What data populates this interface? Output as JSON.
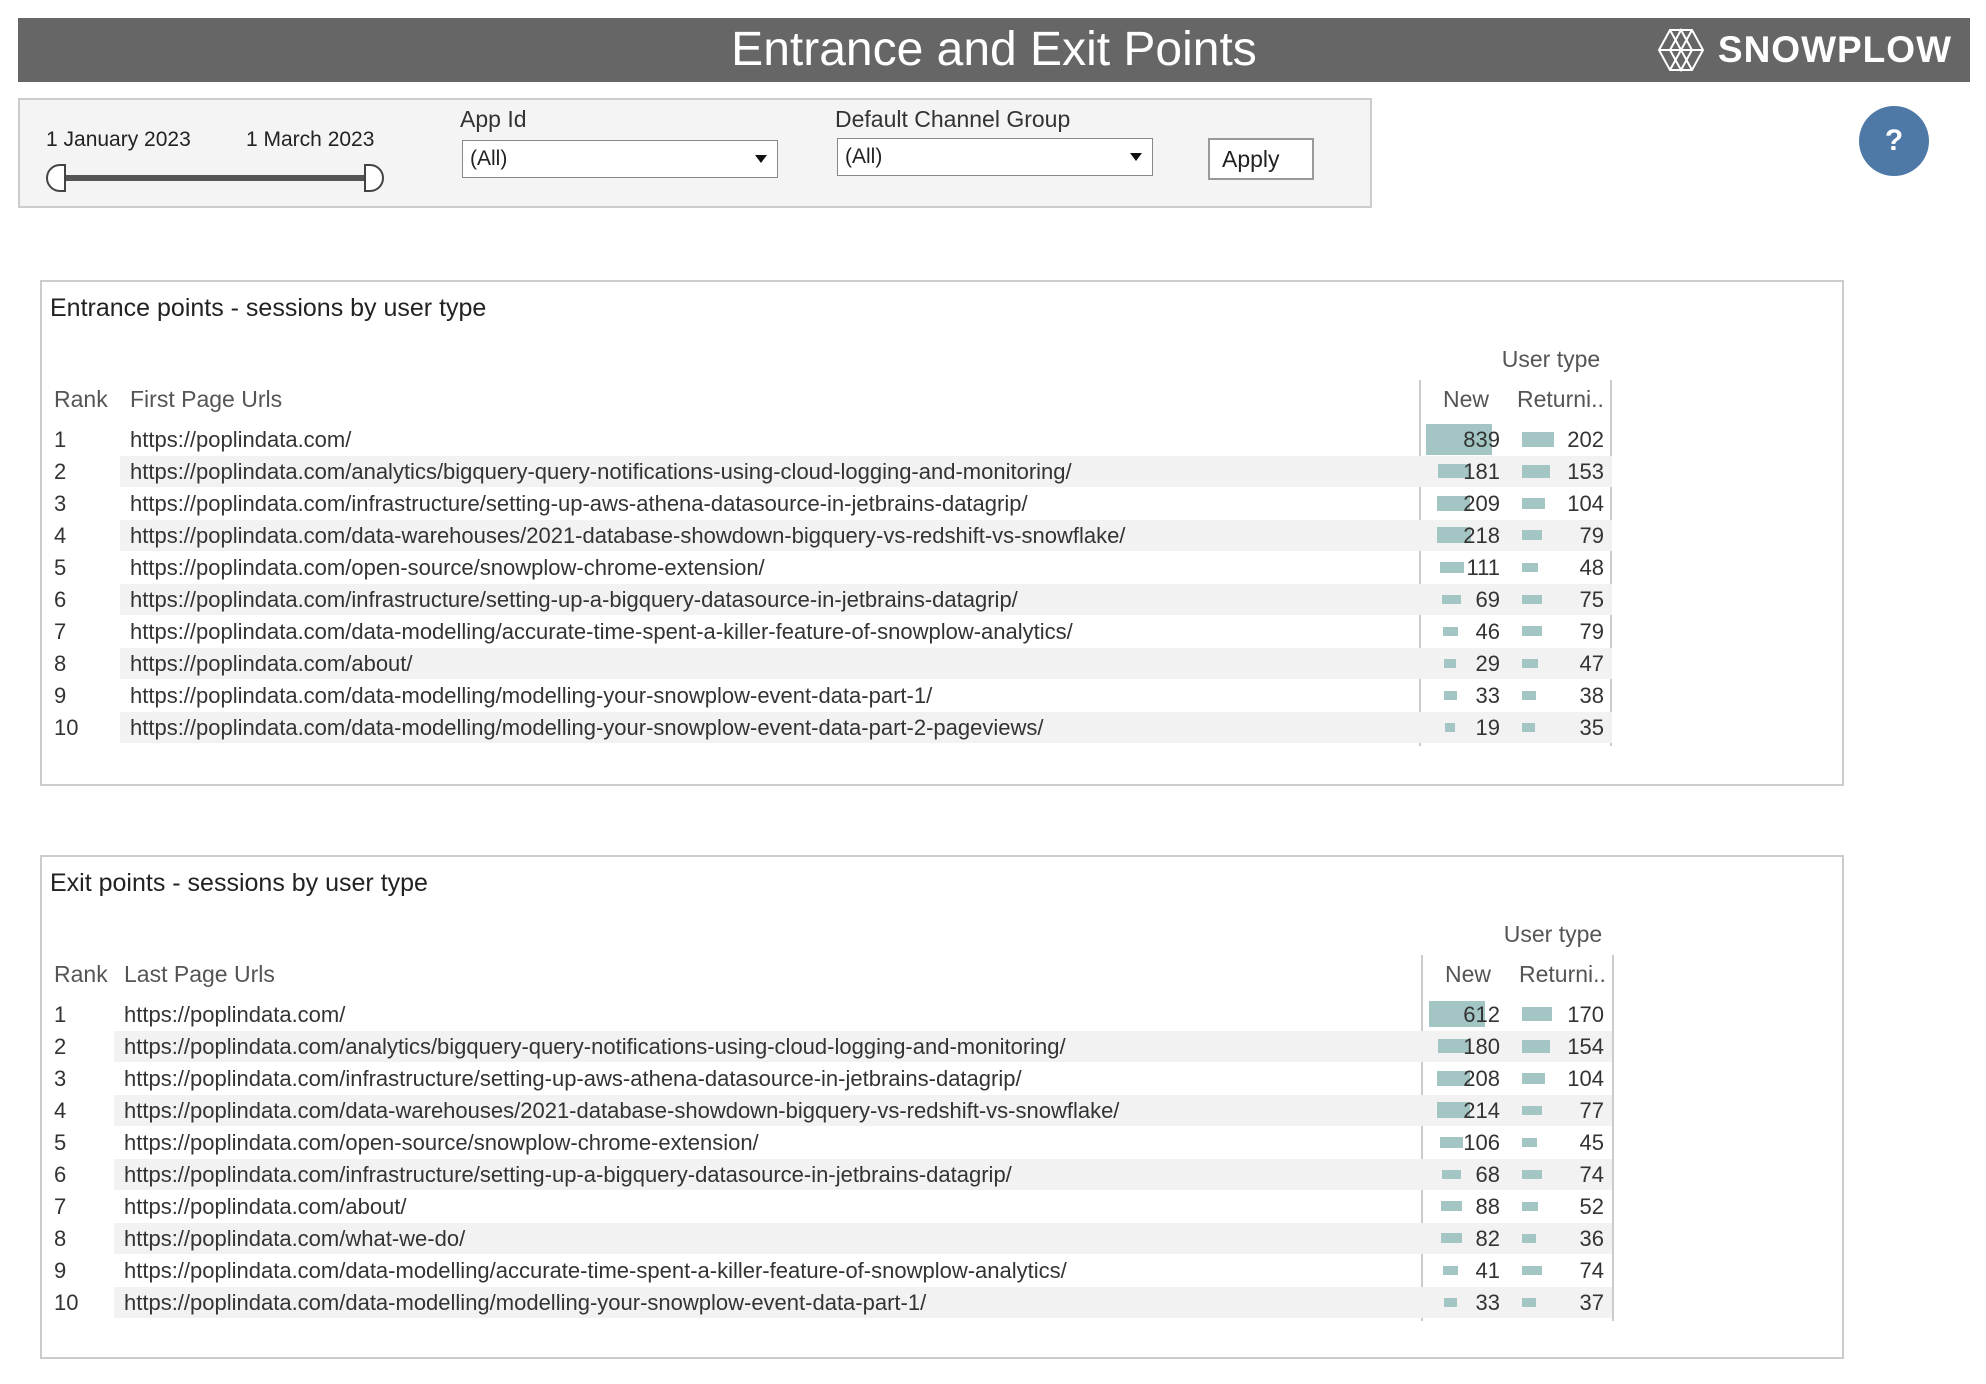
{
  "header": {
    "title": "Entrance and Exit Points",
    "logo_text": "SNOWPLOW",
    "background": "#666666"
  },
  "filters": {
    "date_start": "1 January 2023",
    "date_end": "1 March 2023",
    "app_id_label": "App Id",
    "app_id_value": "(All)",
    "channel_label": "Default Channel Group",
    "channel_value": "(All)",
    "apply_label": "Apply"
  },
  "help_label": "?",
  "entrance": {
    "title": "Entrance points - sessions by user type",
    "user_type_label": "User type",
    "rank_label": "Rank",
    "url_label": "First Page Urls",
    "new_label": "New",
    "returning_label": "Returni..",
    "rows": [
      {
        "rank": "1",
        "url": "https://poplindata.com/",
        "new": 839,
        "returning": 202
      },
      {
        "rank": "2",
        "url": "https://poplindata.com/analytics/bigquery-query-notifications-using-cloud-logging-and-monitoring/",
        "new": 181,
        "returning": 153
      },
      {
        "rank": "3",
        "url": "https://poplindata.com/infrastructure/setting-up-aws-athena-datasource-in-jetbrains-datagrip/",
        "new": 209,
        "returning": 104
      },
      {
        "rank": "4",
        "url": "https://poplindata.com/data-warehouses/2021-database-showdown-bigquery-vs-redshift-vs-snowflake/",
        "new": 218,
        "returning": 79
      },
      {
        "rank": "5",
        "url": "https://poplindata.com/open-source/snowplow-chrome-extension/",
        "new": 111,
        "returning": 48
      },
      {
        "rank": "6",
        "url": "https://poplindata.com/infrastructure/setting-up-a-bigquery-datasource-in-jetbrains-datagrip/",
        "new": 69,
        "returning": 75
      },
      {
        "rank": "7",
        "url": "https://poplindata.com/data-modelling/accurate-time-spent-a-killer-feature-of-snowplow-analytics/",
        "new": 46,
        "returning": 79
      },
      {
        "rank": "8",
        "url": "https://poplindata.com/about/",
        "new": 29,
        "returning": 47
      },
      {
        "rank": "9",
        "url": "https://poplindata.com/data-modelling/modelling-your-snowplow-event-data-part-1/",
        "new": 33,
        "returning": 38
      },
      {
        "rank": "10",
        "url": "https://poplindata.com/data-modelling/modelling-your-snowplow-event-data-part-2-pageviews/",
        "new": 19,
        "returning": 35
      }
    ]
  },
  "exit": {
    "title": "Exit points - sessions by user type",
    "user_type_label": "User type",
    "rank_label": "Rank",
    "url_label": "Last Page Urls",
    "new_label": "New",
    "returning_label": "Returni..",
    "rows": [
      {
        "rank": "1",
        "url": "https://poplindata.com/",
        "new": 612,
        "returning": 170
      },
      {
        "rank": "2",
        "url": "https://poplindata.com/analytics/bigquery-query-notifications-using-cloud-logging-and-monitoring/",
        "new": 180,
        "returning": 154
      },
      {
        "rank": "3",
        "url": "https://poplindata.com/infrastructure/setting-up-aws-athena-datasource-in-jetbrains-datagrip/",
        "new": 208,
        "returning": 104
      },
      {
        "rank": "4",
        "url": "https://poplindata.com/data-warehouses/2021-database-showdown-bigquery-vs-redshift-vs-snowflake/",
        "new": 214,
        "returning": 77
      },
      {
        "rank": "5",
        "url": "https://poplindata.com/open-source/snowplow-chrome-extension/",
        "new": 106,
        "returning": 45
      },
      {
        "rank": "6",
        "url": "https://poplindata.com/infrastructure/setting-up-a-bigquery-datasource-in-jetbrains-datagrip/",
        "new": 68,
        "returning": 74
      },
      {
        "rank": "7",
        "url": "https://poplindata.com/about/",
        "new": 88,
        "returning": 52
      },
      {
        "rank": "8",
        "url": "https://poplindata.com/what-we-do/",
        "new": 82,
        "returning": 36
      },
      {
        "rank": "9",
        "url": "https://poplindata.com/data-modelling/accurate-time-spent-a-killer-feature-of-snowplow-analytics/",
        "new": 41,
        "returning": 74
      },
      {
        "rank": "10",
        "url": "https://poplindata.com/data-modelling/modelling-your-snowplow-event-data-part-1/",
        "new": 33,
        "returning": 37
      }
    ]
  },
  "colors": {
    "bar": "#a3c6c4",
    "band": "#f2f2f2",
    "help": "#4e79a7"
  }
}
